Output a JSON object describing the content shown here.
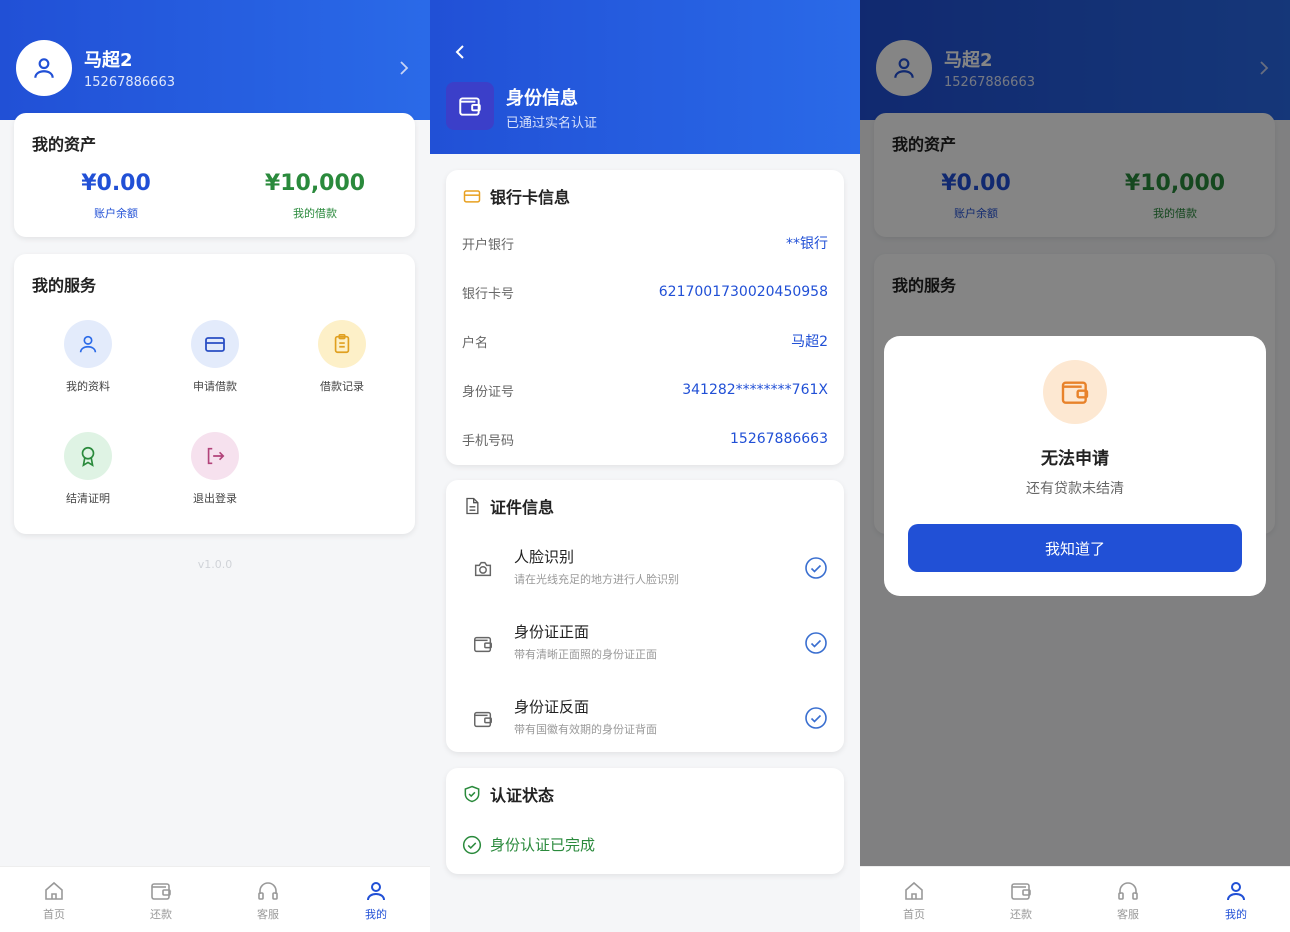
{
  "profile": {
    "user": {
      "name": "马超2",
      "phone": "15267886663"
    },
    "assets": {
      "title": "我的资产",
      "balance_value": "¥0.00",
      "balance_label": "账户余额",
      "loan_value": "¥10,000",
      "loan_label": "我的借款"
    },
    "services": {
      "title": "我的服务",
      "items": [
        {
          "label": "我的资料",
          "icon": "user-icon"
        },
        {
          "label": "申请借款",
          "icon": "card-icon"
        },
        {
          "label": "借款记录",
          "icon": "clipboard-icon"
        },
        {
          "label": "结清证明",
          "icon": "award-icon"
        },
        {
          "label": "退出登录",
          "icon": "logout-icon"
        }
      ]
    },
    "version": "v1.0.0"
  },
  "tabbar": {
    "items": [
      {
        "label": "首页",
        "icon": "home-icon"
      },
      {
        "label": "还款",
        "icon": "wallet-icon"
      },
      {
        "label": "客服",
        "icon": "headset-icon"
      },
      {
        "label": "我的",
        "icon": "user-icon"
      }
    ],
    "active_index": 3
  },
  "identity": {
    "title": "身份信息",
    "subtitle": "已通过实名认证",
    "bank": {
      "title": "银行卡信息",
      "rows": [
        {
          "label": "开户银行",
          "value": "**银行"
        },
        {
          "label": "银行卡号",
          "value": "6217001730020450958"
        },
        {
          "label": "户名",
          "value": "马超2"
        },
        {
          "label": "身份证号",
          "value": "341282********761X"
        },
        {
          "label": "手机号码",
          "value": "15267886663"
        }
      ]
    },
    "docs": {
      "title": "证件信息",
      "items": [
        {
          "title": "人脸识别",
          "subtitle": "请在光线充足的地方进行人脸识别",
          "icon": "camera-icon"
        },
        {
          "title": "身份证正面",
          "subtitle": "带有清晰正面照的身份证正面",
          "icon": "id-card-icon"
        },
        {
          "title": "身份证反面",
          "subtitle": "带有国徽有效期的身份证背面",
          "icon": "id-card-icon"
        }
      ]
    },
    "status": {
      "title": "认证状态",
      "text": "身份认证已完成"
    }
  },
  "dialog": {
    "title": "无法申请",
    "message": "还有贷款未结清",
    "button": "我知道了",
    "icon": "wallet-icon"
  },
  "colors": {
    "primary": "#2150d6",
    "balance": "#2150d6",
    "loan": "#2a8a3c",
    "dialog_icon_bg": "#fde8d2",
    "dialog_icon": "#e8822a"
  }
}
